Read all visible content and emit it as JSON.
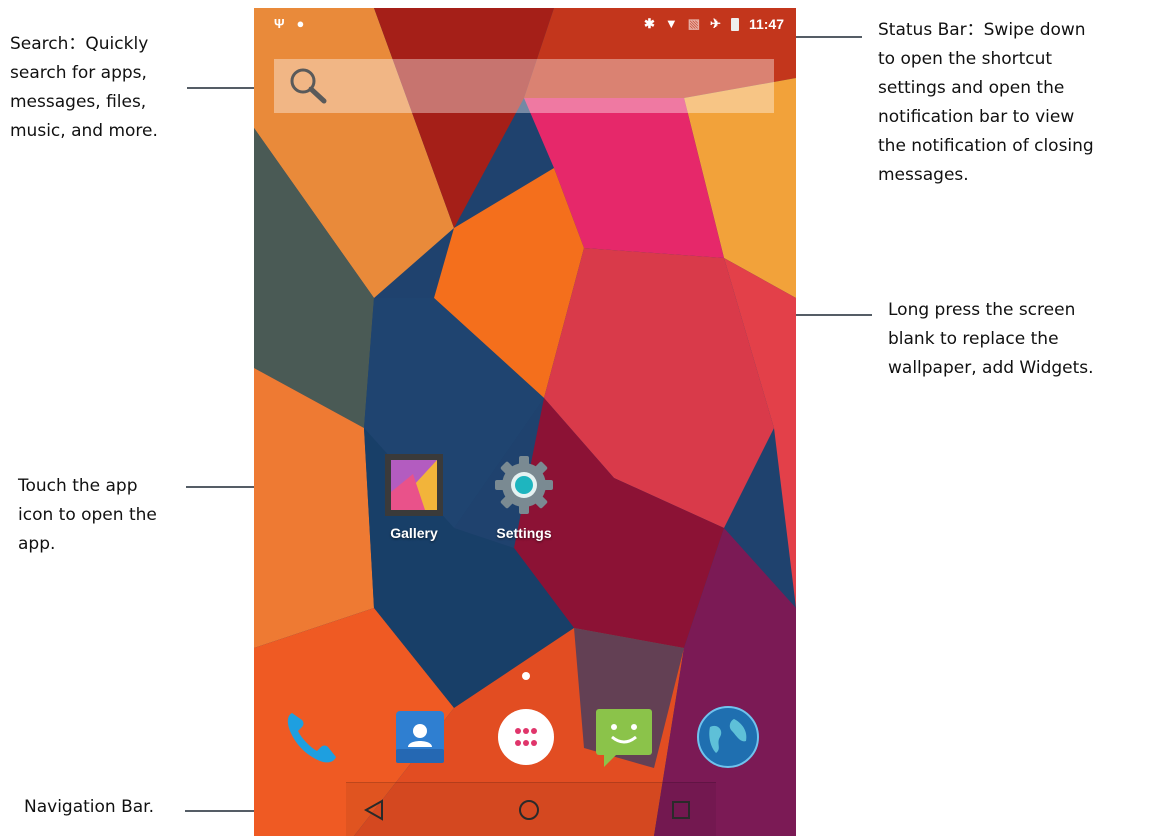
{
  "status_bar": {
    "time": "11:47",
    "left_icons": [
      "usb-icon",
      "android-debug-icon"
    ],
    "right_icons": [
      "bluetooth-icon",
      "wifi-icon",
      "no-sim-icon",
      "airplane-mode-icon",
      "battery-icon"
    ]
  },
  "search": {
    "icon": "search-icon"
  },
  "home_apps": [
    {
      "label": "Gallery",
      "icon": "gallery-icon"
    },
    {
      "label": "Settings",
      "icon": "gear-icon"
    }
  ],
  "dock": [
    {
      "icon": "phone-icon"
    },
    {
      "icon": "contacts-icon"
    },
    {
      "icon": "app-drawer-icon"
    },
    {
      "icon": "messaging-icon"
    },
    {
      "icon": "browser-globe-icon"
    }
  ],
  "nav_bar": {
    "buttons": [
      "back-icon",
      "home-icon",
      "recents-icon"
    ]
  },
  "annotations": {
    "search": "Search：Quickly\nsearch for apps,\n messages, files,\n music, and more.",
    "status_bar": "Status Bar：Swipe down\nto open the shortcut\nsettings and open the\nnotification bar to view\nthe notification of closing\nmessages.",
    "wallpaper": "Long press the screen\nblank to replace the\nwallpaper, add Widgets.",
    "app_icon": "Touch the app\nicon to open the\n app.",
    "navigation": "Navigation Bar."
  },
  "colors": {
    "accent_orange": "#f26b1d",
    "accent_pink": "#e8336f",
    "wallpaper_blue": "#1d3f6a"
  }
}
